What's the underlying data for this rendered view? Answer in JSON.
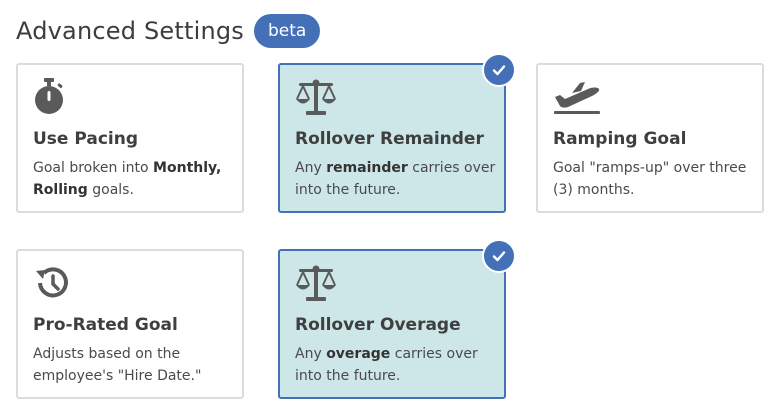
{
  "header": {
    "title": "Advanced Settings",
    "badge": "beta"
  },
  "cards": [
    {
      "title": "Use Pacing",
      "desc_pre": "Goal broken into ",
      "desc_bold1": "Monthly,",
      "desc_mid": " ",
      "desc_bold2": "Rolling",
      "desc_post": " goals.",
      "icon": "stopwatch-icon",
      "selected": false
    },
    {
      "title": "Rollover Remainder",
      "desc_pre": "Any ",
      "desc_bold1": "remainder",
      "desc_post": " carries over into the future.",
      "icon": "scales-icon",
      "selected": true
    },
    {
      "title": "Ramping Goal",
      "desc": "Goal \"ramps-up\" over three (3) months.",
      "icon": "airplane-takeoff-icon",
      "selected": false
    },
    {
      "title": "Pro-Rated Goal",
      "desc": "Adjusts based on the employee's \"Hire Date.\"",
      "icon": "history-icon",
      "selected": false
    },
    {
      "title": "Rollover Overage",
      "desc_pre": "Any ",
      "desc_bold1": "overage",
      "desc_post": " carries over into the future.",
      "icon": "scales-icon",
      "selected": true
    }
  ],
  "colors": {
    "accent": "#4470b8",
    "selected_bg": "#cde6e8",
    "icon": "#5a5a5a"
  }
}
